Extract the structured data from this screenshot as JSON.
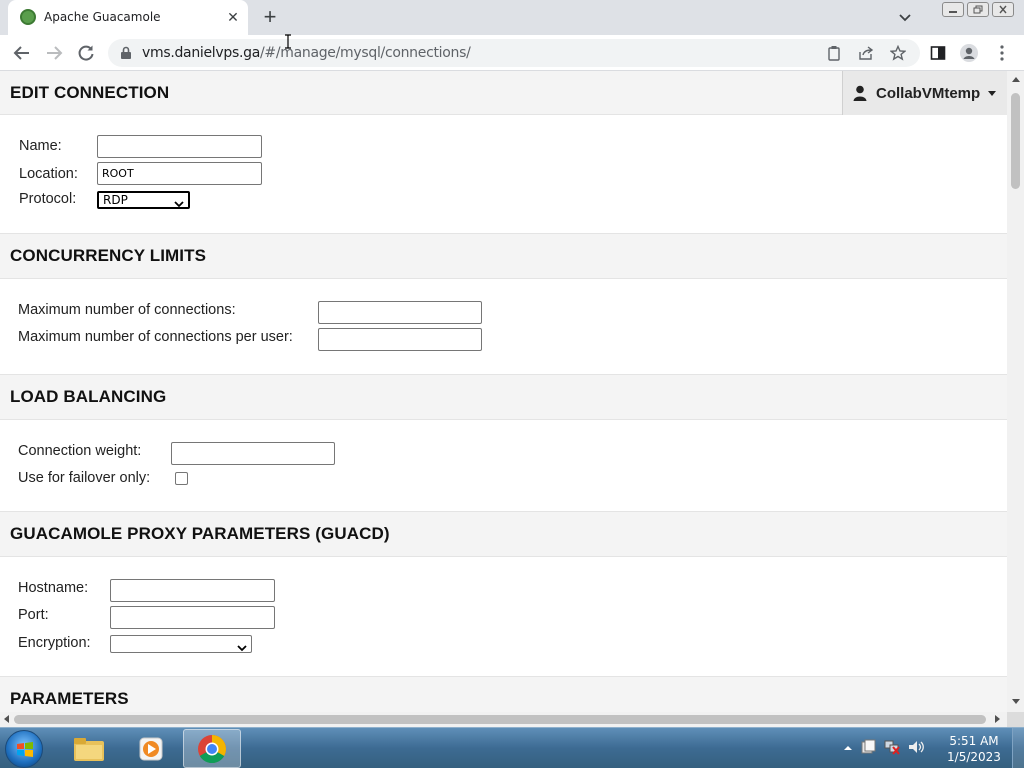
{
  "browser": {
    "tab_title": "Apache Guacamole",
    "tab_close": "✕",
    "new_tab": "+",
    "url_host": "vms.danielvps.ga",
    "url_path": "/#/manage/mysql/connections/"
  },
  "header": {
    "title": "EDIT CONNECTION",
    "user": "CollabVMtemp"
  },
  "connection": {
    "name_label": "Name:",
    "name_value": "",
    "location_label": "Location:",
    "location_value": "ROOT",
    "protocol_label": "Protocol:",
    "protocol_value": "RDP"
  },
  "concurrency": {
    "title": "CONCURRENCY LIMITS",
    "max_connections_label": "Maximum number of connections:",
    "max_connections_per_user_label": "Maximum number of connections per user:"
  },
  "load_balancing": {
    "title": "LOAD BALANCING",
    "weight_label": "Connection weight:",
    "failover_label": "Use for failover only:",
    "failover_checked": false
  },
  "guacd": {
    "title": "GUACAMOLE PROXY PARAMETERS (GUACD)",
    "hostname_label": "Hostname:",
    "port_label": "Port:",
    "encryption_label": "Encryption:",
    "encryption_value": ""
  },
  "parameters": {
    "title": "PARAMETERS"
  },
  "taskbar": {
    "time": "5:51 AM",
    "date": "1/5/2023"
  }
}
